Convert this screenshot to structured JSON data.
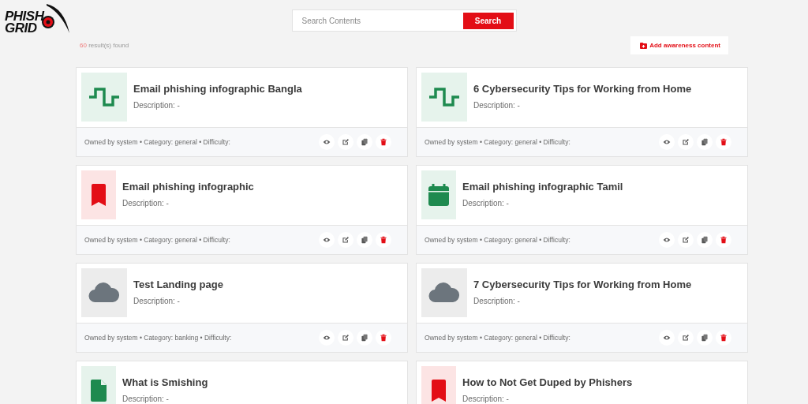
{
  "logo": {
    "line_1": "PHISH",
    "line_2": "GRID"
  },
  "search": {
    "placeholder": "Search Contents",
    "button": "Search"
  },
  "results": {
    "count": "60",
    "label": "result(s) found"
  },
  "add_button": "Add awareness content",
  "cards": [
    {
      "kind": "wave",
      "title": "Email phishing infographic Bangla",
      "description": "Description: -",
      "meta": "Owned by system • Category: general • Difficulty:"
    },
    {
      "kind": "wave",
      "title": "6 Cybersecurity Tips for Working from Home",
      "description": "Description: -",
      "meta": "Owned by system • Category: general • Difficulty:"
    },
    {
      "kind": "bookmark",
      "title": "Email phishing infographic",
      "description": "Description: -",
      "meta": "Owned by system • Category: general • Difficulty:"
    },
    {
      "kind": "calendar",
      "title": "Email phishing infographic Tamil",
      "description": "Description: -",
      "meta": "Owned by system • Category: general • Difficulty:"
    },
    {
      "kind": "cloud",
      "title": "Test Landing page",
      "description": "Description: -",
      "meta": "Owned by system • Category: banking • Difficulty:"
    },
    {
      "kind": "cloud",
      "title": "7 Cybersecurity Tips for Working from Home",
      "description": "Description: -",
      "meta": "Owned by system • Category: general • Difficulty:"
    },
    {
      "kind": "file",
      "title": "What is Smishing",
      "description": "Description: -"
    },
    {
      "kind": "bookmark",
      "title": "How to Not Get Duped by Phishers",
      "description": "Description: -"
    }
  ]
}
